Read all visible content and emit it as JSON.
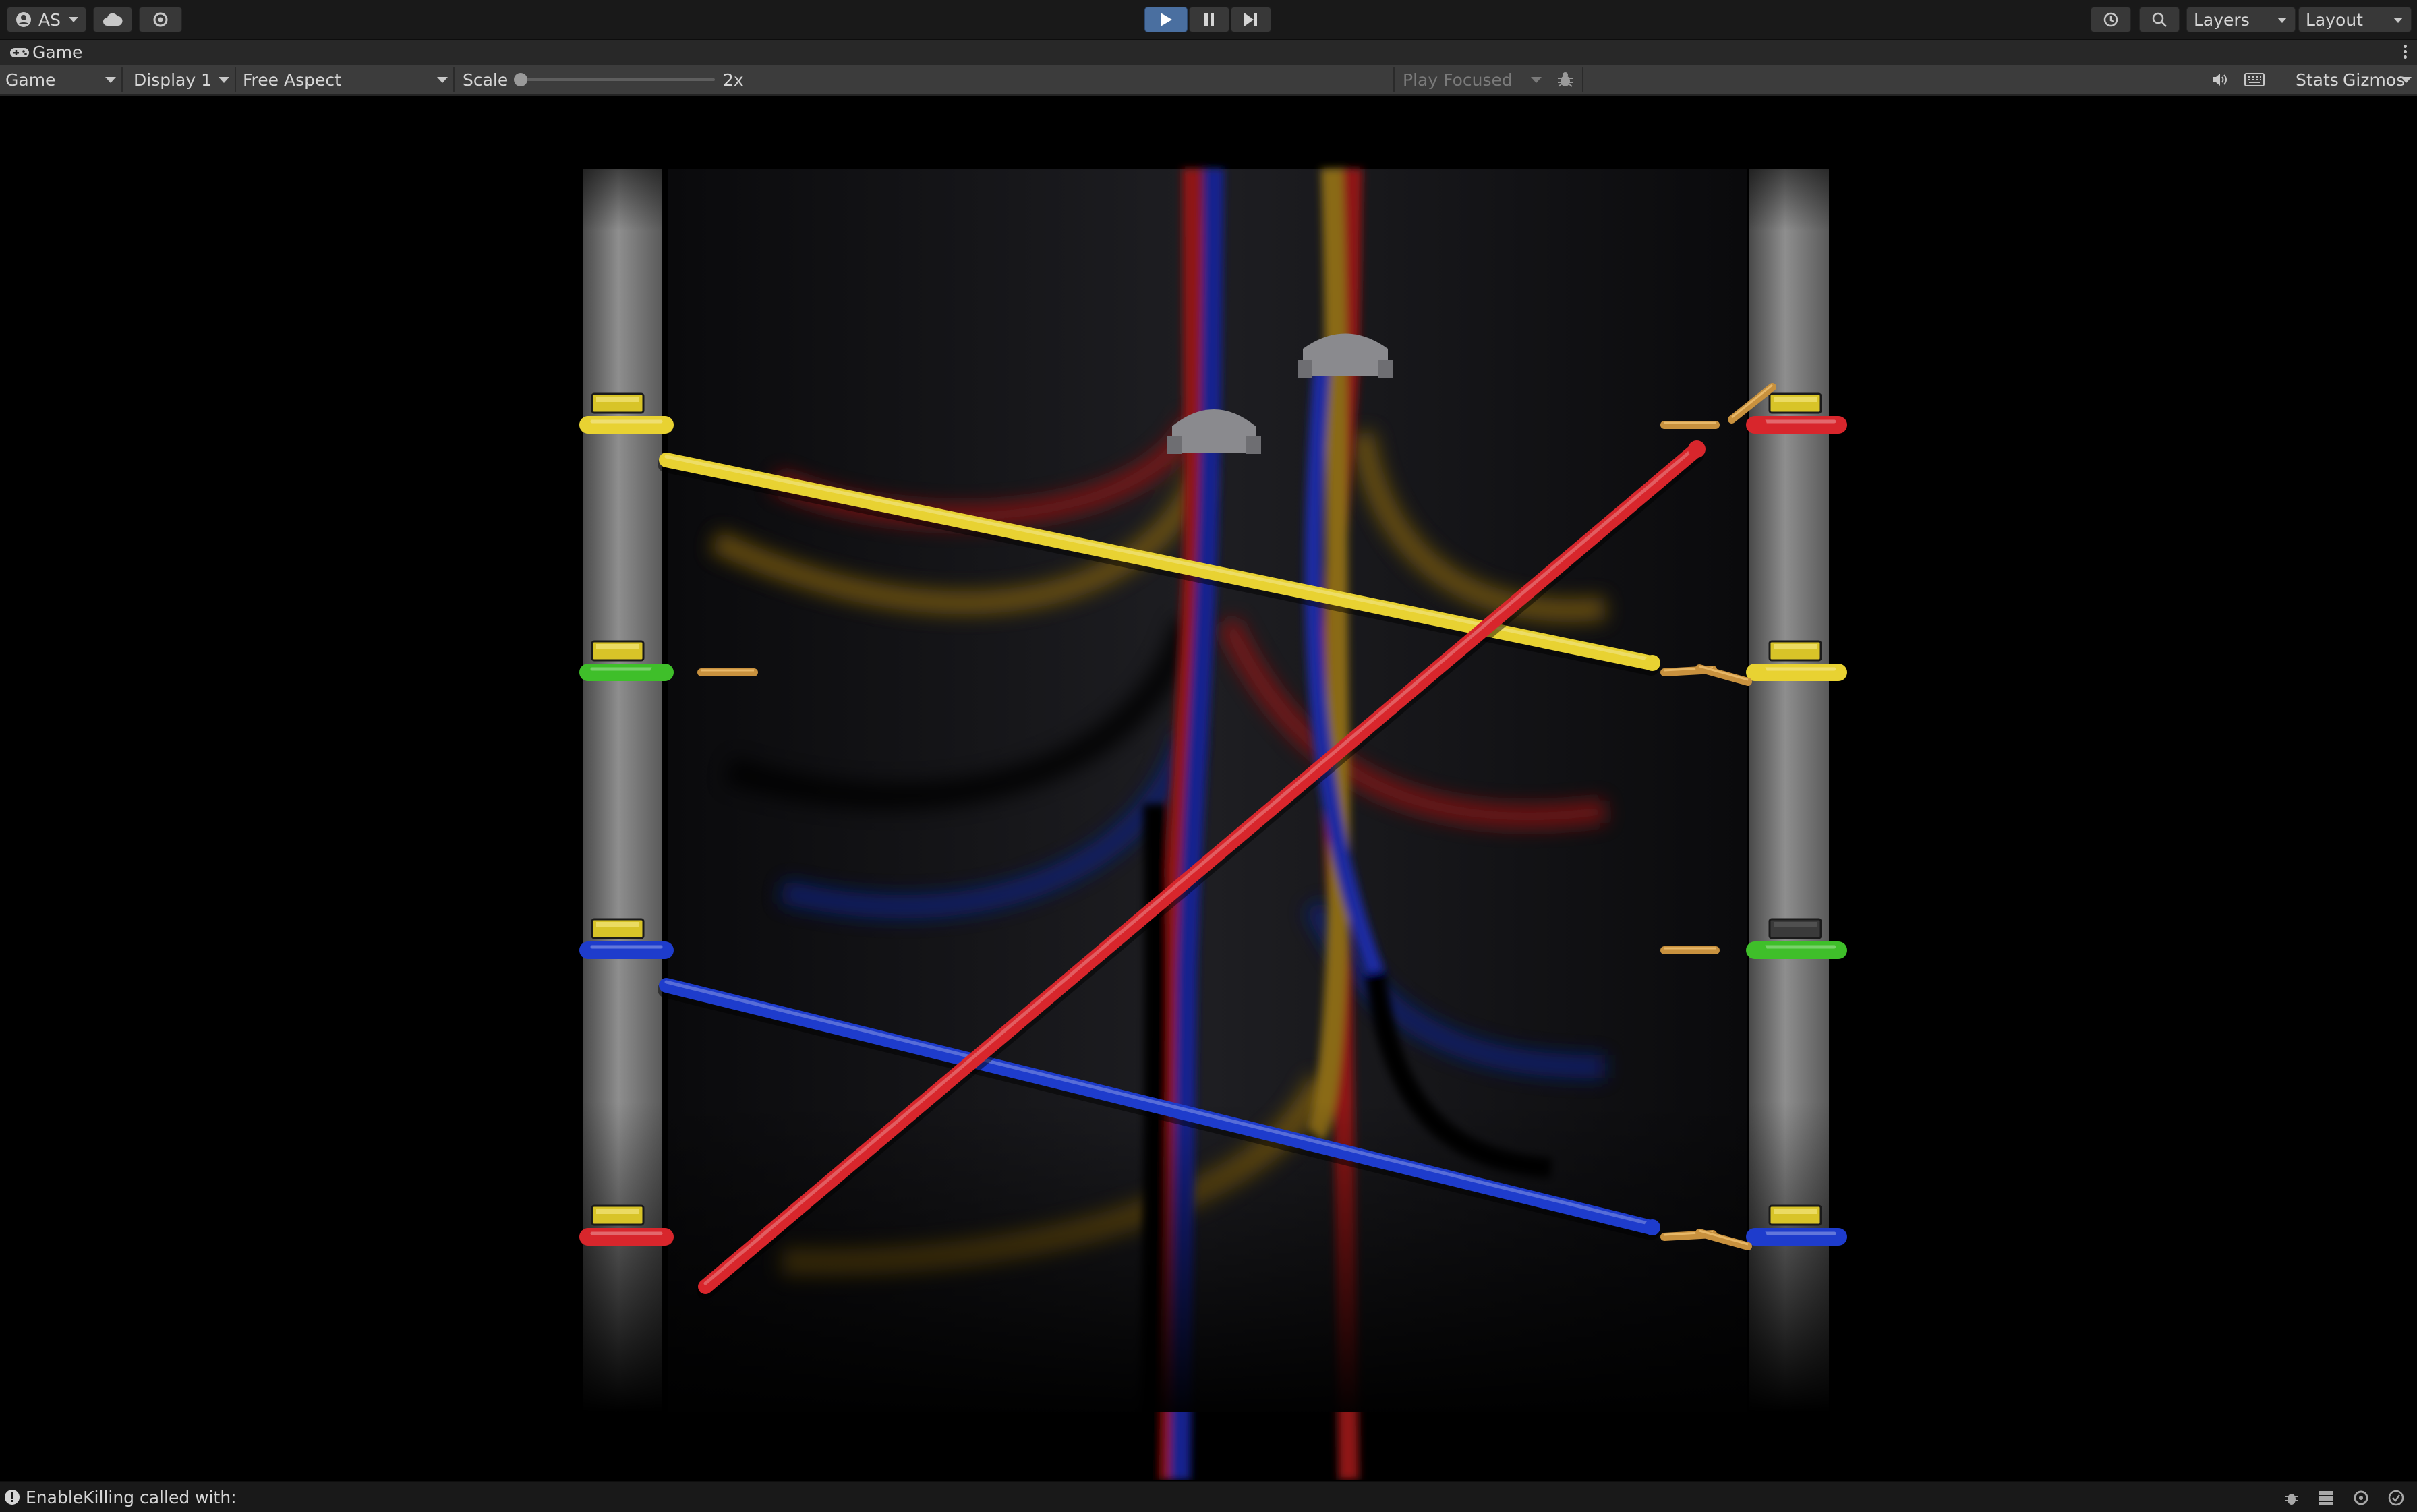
{
  "toolbar": {
    "account_label": "AS",
    "layers_label": "Layers",
    "layout_label": "Layout"
  },
  "tab": {
    "title": "Game"
  },
  "game_toolbar": {
    "view_mode": "Game",
    "display": "Display 1",
    "aspect": "Free Aspect",
    "scale_label": "Scale",
    "scale_value": "2x",
    "scale_level": 0.0,
    "play_mode": "Play Focused",
    "stats_label": "Stats",
    "gizmos_label": "Gizmos"
  },
  "status": {
    "message": "EnableKilling called with:"
  },
  "wires": {
    "left_plugs": [
      "yellow",
      "green",
      "blue",
      "red"
    ],
    "right_plugs": [
      "red",
      "yellow",
      "green",
      "blue"
    ],
    "connected": [
      {
        "from": "yellow",
        "left_index": 0,
        "right_index": 1
      },
      {
        "from": "blue",
        "left_index": 2,
        "right_index": 3
      }
    ],
    "dragging": {
      "color": "red",
      "left_index": 3
    },
    "colors": {
      "yellow": "#e8d232",
      "green": "#3fbf2a",
      "blue": "#1e3ccc",
      "red": "#d8262c"
    }
  }
}
